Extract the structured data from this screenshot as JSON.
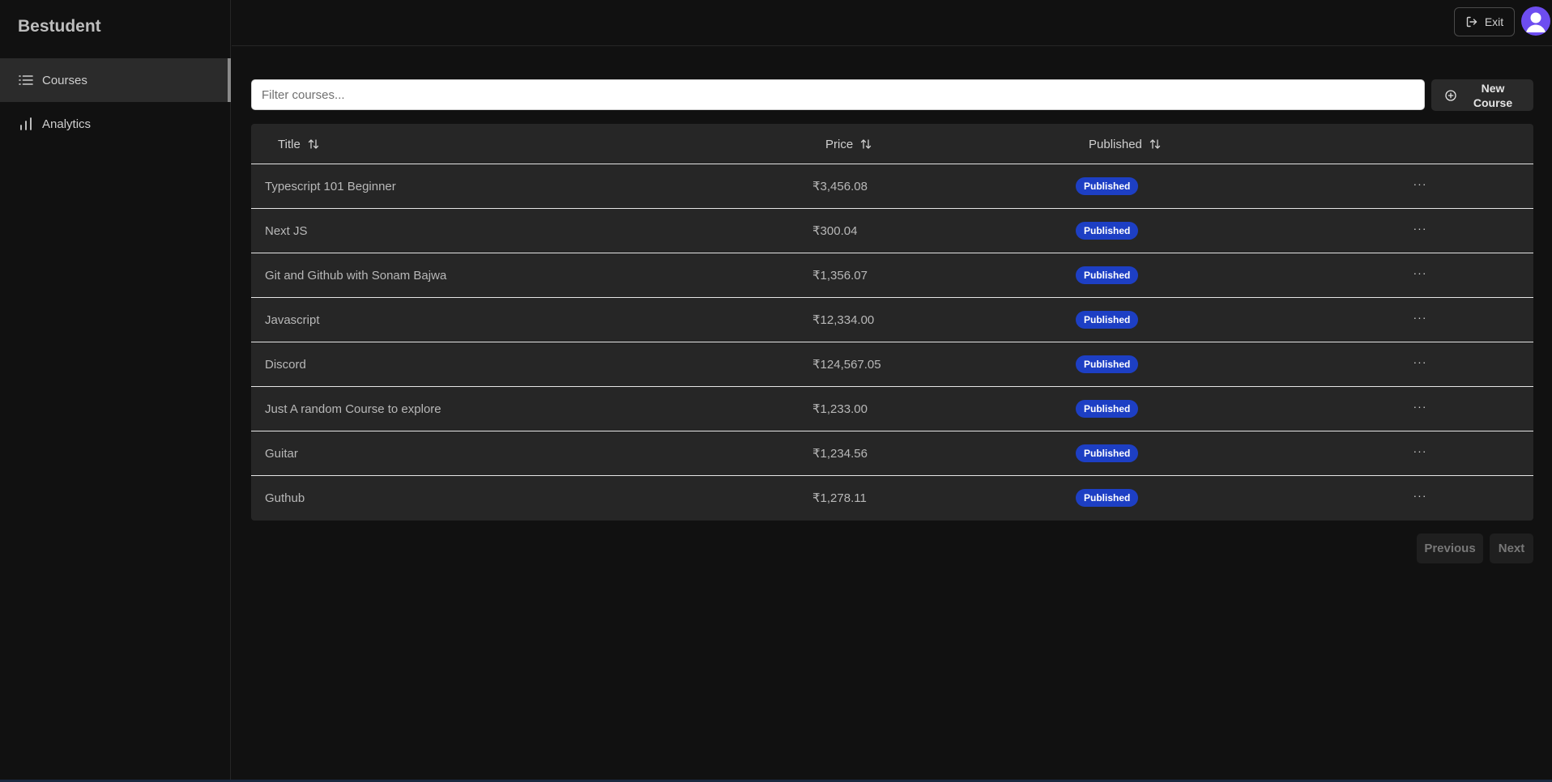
{
  "app": {
    "brand": "Bestudent"
  },
  "sidebar": {
    "items": [
      {
        "label": "Courses",
        "icon": "list-icon",
        "active": true
      },
      {
        "label": "Analytics",
        "icon": "bar-chart-icon",
        "active": false
      }
    ]
  },
  "header": {
    "exit_label": "Exit"
  },
  "toolbar": {
    "filter_placeholder": "Filter courses...",
    "filter_value": "",
    "new_course_label_line1": "New",
    "new_course_label_line2": "Course"
  },
  "table": {
    "columns": [
      "Title",
      "Price",
      "Published"
    ],
    "rows": [
      {
        "title": "Typescript 101 Beginner",
        "price": "₹3,456.08",
        "status": "Published"
      },
      {
        "title": "Next JS",
        "price": "₹300.04",
        "status": "Published"
      },
      {
        "title": "Git and Github with Sonam Bajwa",
        "price": "₹1,356.07",
        "status": "Published"
      },
      {
        "title": "Javascript",
        "price": "₹12,334.00",
        "status": "Published"
      },
      {
        "title": "Discord",
        "price": "₹124,567.05",
        "status": "Published"
      },
      {
        "title": "Just A random Course to explore",
        "price": "₹1,233.00",
        "status": "Published"
      },
      {
        "title": "Guitar",
        "price": "₹1,234.56",
        "status": "Published"
      },
      {
        "title": "Guthub",
        "price": "₹1,278.11",
        "status": "Published"
      }
    ],
    "more_glyph": "···"
  },
  "pagination": {
    "previous_label": "Previous",
    "next_label": "Next"
  },
  "colors": {
    "badge": "#1d3fc4",
    "avatar": "#6d4df0",
    "background": "#111111"
  }
}
